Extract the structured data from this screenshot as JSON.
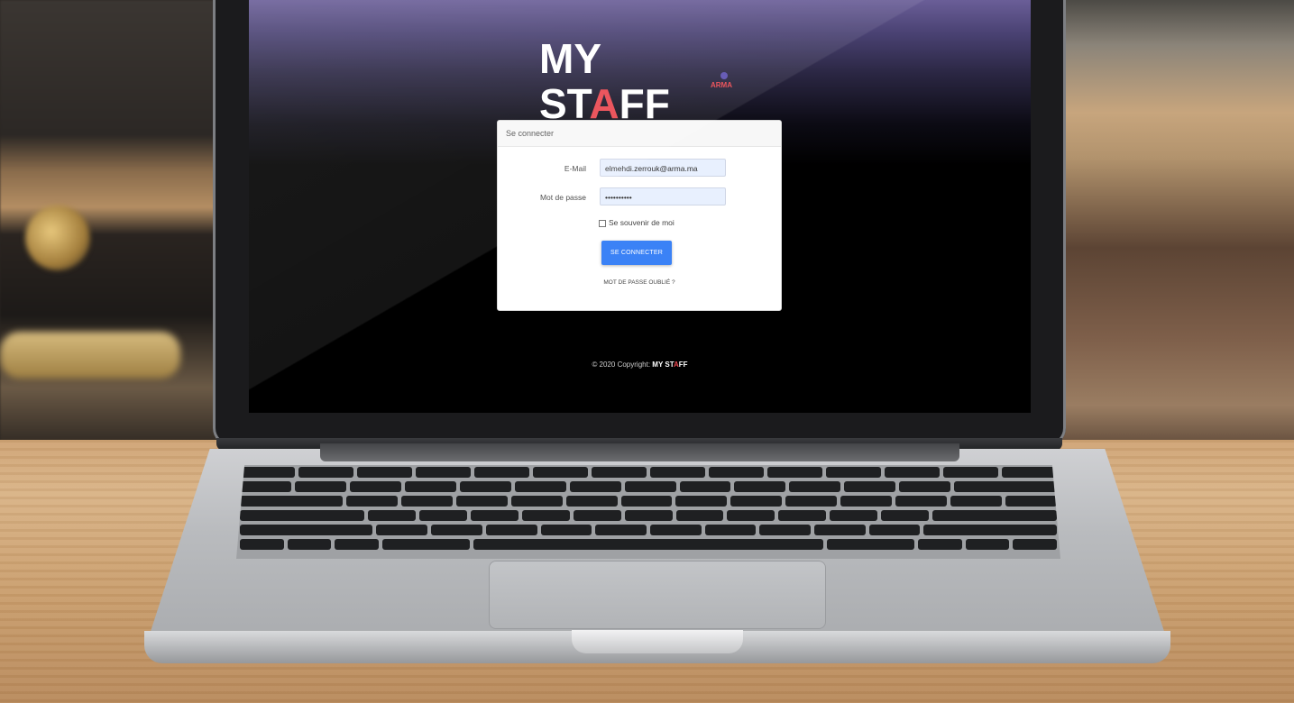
{
  "app": {
    "logo": {
      "part1": "MY ST",
      "accent": "A",
      "part2": "FF",
      "sub": "ARMA"
    }
  },
  "login": {
    "header": "Se connecter",
    "email": {
      "label": "E-Mail",
      "value": "elmehdi.zerrouk@arma.ma"
    },
    "password": {
      "label": "Mot de passe",
      "value": "••••••••••"
    },
    "remember_label": "Se souvenir de moi",
    "submit_label": "SE CONNECTER",
    "forgot_label": "MOT DE PASSE OUBLIÉ ?"
  },
  "footer": {
    "copyright": "© 2020 Copyright:",
    "brand_part1": "MY ST",
    "brand_accent": "A",
    "brand_part2": "FF"
  },
  "colors": {
    "accent": "#e9474f",
    "primary_button": "#3b82f6",
    "input_bg": "#e8f0fe"
  }
}
